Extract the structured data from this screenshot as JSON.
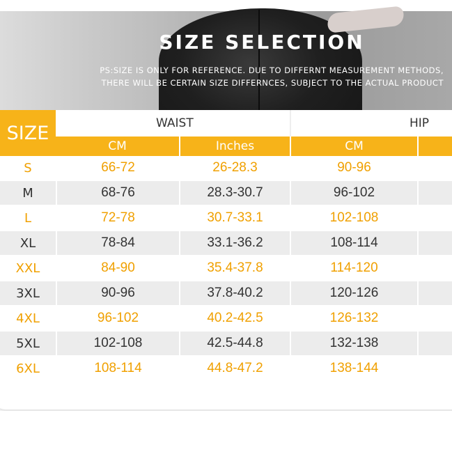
{
  "banner": {
    "title": "SIZE SELECTION",
    "note_line1": "PS:SIZE IS ONLY FOR REFERENCE. DUE TO DIFFERNT MEASUREMENT METHODS,",
    "note_line2": "THERE WILL BE CERTAIN SIZE DIFFERNCES, SUBJECT TO THE ACTUAL PRODUCT"
  },
  "table": {
    "size_header": "SIZE",
    "waist_header": "WAIST",
    "hip_header": "HIP",
    "units": [
      "CM",
      "Inches",
      "CM"
    ],
    "rows": [
      {
        "size": "S",
        "waist_cm": "66-72",
        "waist_in": "26-28.3",
        "hip_cm": "90-96"
      },
      {
        "size": "M",
        "waist_cm": "68-76",
        "waist_in": "28.3-30.7",
        "hip_cm": "96-102"
      },
      {
        "size": "L",
        "waist_cm": "72-78",
        "waist_in": "30.7-33.1",
        "hip_cm": "102-108"
      },
      {
        "size": "XL",
        "waist_cm": "78-84",
        "waist_in": "33.1-36.2",
        "hip_cm": "108-114"
      },
      {
        "size": "XXL",
        "waist_cm": "84-90",
        "waist_in": "35.4-37.8",
        "hip_cm": "114-120"
      },
      {
        "size": "3XL",
        "waist_cm": "90-96",
        "waist_in": "37.8-40.2",
        "hip_cm": "120-126"
      },
      {
        "size": "4XL",
        "waist_cm": "96-102",
        "waist_in": "40.2-42.5",
        "hip_cm": "126-132"
      },
      {
        "size": "5XL",
        "waist_cm": "102-108",
        "waist_in": "42.5-44.8",
        "hip_cm": "132-138"
      },
      {
        "size": "6XL",
        "waist_cm": "108-114",
        "waist_in": "44.8-47.2",
        "hip_cm": "138-144"
      }
    ]
  },
  "colors": {
    "accent": "#f7b319",
    "highlight_text": "#f0a000",
    "dark_text": "#333333",
    "stripe": "#ececec"
  }
}
